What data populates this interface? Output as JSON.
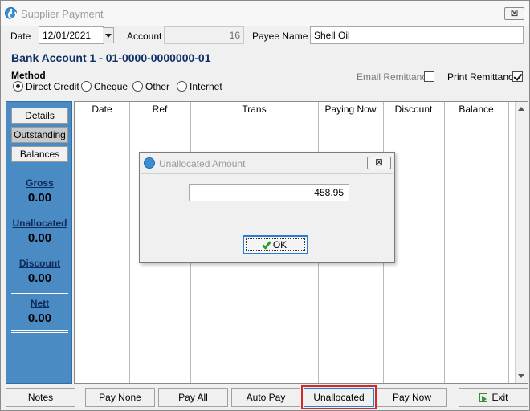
{
  "window": {
    "title": "Supplier Payment",
    "close_glyph": "⊠"
  },
  "header": {
    "date_label": "Date",
    "date_value": "12/01/2021",
    "account_label": "Account",
    "account_value": "16",
    "payee_label": "Payee Name",
    "payee_value": "Shell Oil",
    "bank_account": "Bank Account 1 - 01-0000-0000000-01"
  },
  "method": {
    "label": "Method",
    "options": [
      "Direct Credit",
      "Cheque",
      "Other",
      "Internet"
    ],
    "selected": "Direct Credit"
  },
  "remittance": {
    "email_label": "Email Remittance",
    "email_checked": false,
    "print_label": "Print Remittance",
    "print_checked": true
  },
  "sidebar": {
    "buttons": [
      "Details",
      "Outstanding",
      "Balances"
    ],
    "active": "Outstanding",
    "stats": [
      {
        "label": "Gross",
        "value": "0.00"
      },
      {
        "label": "Unallocated",
        "value": "0.00"
      },
      {
        "label": "Discount",
        "value": "0.00"
      },
      {
        "label": "Nett",
        "value": "0.00"
      }
    ]
  },
  "grid": {
    "columns": [
      "Date",
      "Ref",
      "Trans",
      "Paying Now",
      "Discount",
      "Balance"
    ],
    "rows": []
  },
  "dialog": {
    "title": "Unallocated Amount",
    "close_glyph": "⊠",
    "amount": "458.95",
    "ok_label": "OK"
  },
  "footer": {
    "buttons": [
      "Notes",
      "Pay None",
      "Pay All",
      "Auto Pay",
      "Unallocated",
      "Pay Now",
      "Exit"
    ],
    "highlighted": "Unallocated"
  },
  "colors": {
    "sidebar_bg": "#4a8bc4",
    "bank_title": "#0f2f68",
    "highlight_outline": "#d22a2a",
    "focus_border": "#2b7cd3"
  }
}
